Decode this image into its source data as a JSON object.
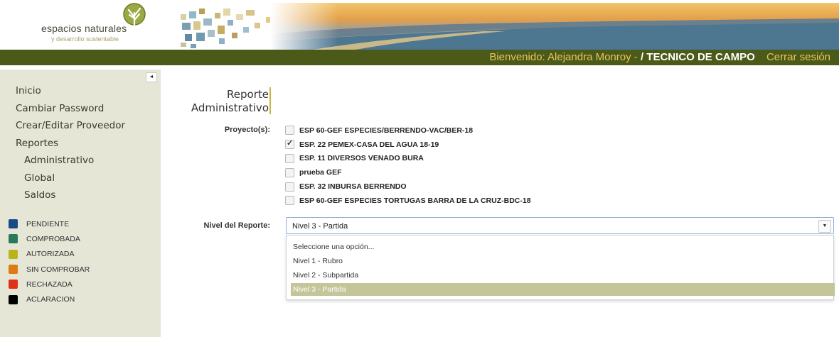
{
  "header": {
    "logo_title": "espacios naturales",
    "logo_subtitle": "y desarrollo sustentable",
    "welcome_prefix": "Bienvenido: Alejandra Monroy -",
    "welcome_role": "/ TECNICO DE CAMPO",
    "logout": "Cerrar sesión"
  },
  "sidebar": {
    "collapse_icon": "◄",
    "menu": [
      {
        "label": "Inicio"
      },
      {
        "label": "Cambiar Password"
      },
      {
        "label": "Crear/Editar Proveedor"
      },
      {
        "label": "Reportes"
      },
      {
        "label": "Administrativo"
      },
      {
        "label": "Global"
      },
      {
        "label": "Saldos"
      }
    ],
    "legend": [
      {
        "label": "PENDIENTE",
        "color": "#1a4a86"
      },
      {
        "label": "COMPROBADA",
        "color": "#2a7a5a"
      },
      {
        "label": "AUTORIZADA",
        "color": "#b8b41a"
      },
      {
        "label": "SIN COMPROBAR",
        "color": "#e07a12"
      },
      {
        "label": "RECHAZADA",
        "color": "#e0301a"
      },
      {
        "label": "ACLARACION",
        "color": "#000000"
      }
    ]
  },
  "main": {
    "title_line1": "Reporte",
    "title_line2": "Administrativo",
    "projects_label": "Proyecto(s):",
    "projects": [
      {
        "label": "ESP 60-GEF ESPECIES/BERRENDO-VAC/BER-18",
        "checked": false
      },
      {
        "label": "ESP. 22 PEMEX-CASA DEL AGUA 18-19",
        "checked": true
      },
      {
        "label": "ESP. 11 DIVERSOS VENADO BURA",
        "checked": false
      },
      {
        "label": "prueba GEF",
        "checked": false
      },
      {
        "label": "ESP. 32 INBURSA BERRENDO",
        "checked": false
      },
      {
        "label": "ESP 60-GEF ESPECIES TORTUGAS BARRA DE LA CRUZ-BDC-18",
        "checked": false
      }
    ],
    "nivel_label": "Nivel del Reporte:",
    "nivel_selected": "Nivel 3 - Partida",
    "nivel_arrow": "▼",
    "nivel_options": [
      {
        "label": "Seleccione una opción..."
      },
      {
        "label": "Nivel 1 - Rubro"
      },
      {
        "label": "Nivel 2 - Subpartida"
      },
      {
        "label": "Nivel 3 - Partida"
      }
    ],
    "nivel_highlighted_index": 3
  }
}
